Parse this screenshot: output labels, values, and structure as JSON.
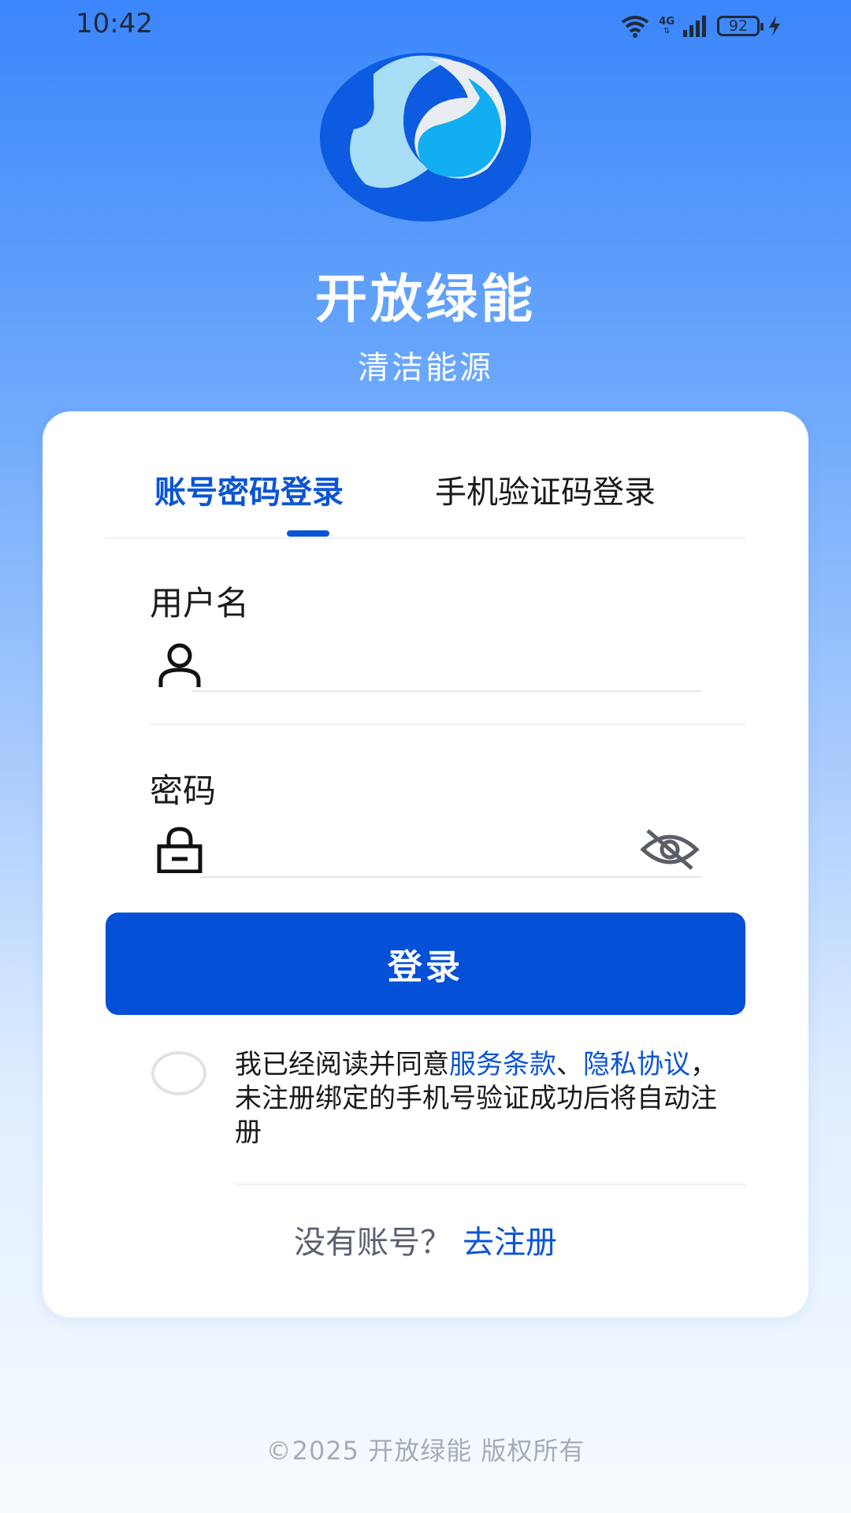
{
  "status_bar": {
    "time": "10:42",
    "network": "4G",
    "battery": "92"
  },
  "app": {
    "title": "开放绿能",
    "subtitle": "清洁能源"
  },
  "tabs": [
    {
      "label": "账号密码登录",
      "active": true
    },
    {
      "label": "手机验证码登录",
      "active": false
    }
  ],
  "form": {
    "username_label": "用户名",
    "username_value": "",
    "password_label": "密码",
    "password_value": "",
    "login_button": "登录"
  },
  "agreement": {
    "prefix": "我已经阅读并同意",
    "terms_link": "服务条款",
    "separator": "、",
    "privacy_link": "隐私协议",
    "suffix": "， 未注册绑定的手机号验证成功后将自动注册"
  },
  "register": {
    "prompt": "没有账号？",
    "link": "去注册"
  },
  "footer": "©2025 开放绿能 版权所有",
  "colors": {
    "primary": "#0450d6",
    "accent_text": "#0a55d4",
    "bg_top": "#3b86fb"
  },
  "icons": [
    "wifi-icon",
    "signal-icon",
    "battery-icon",
    "charging-icon",
    "user-icon",
    "lock-icon",
    "eye-off-icon"
  ]
}
